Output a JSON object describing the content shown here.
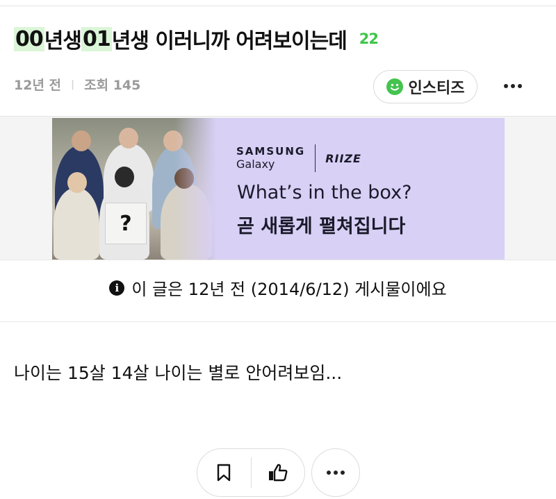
{
  "post": {
    "title_parts": [
      {
        "text": "00",
        "highlight": true
      },
      {
        "text": "년생 ",
        "highlight": false
      },
      {
        "text": "01",
        "highlight": true
      },
      {
        "text": "년생 이러니까 어려보이는데",
        "highlight": false
      }
    ],
    "comment_count": "22",
    "time_ago": "12년 전",
    "views_label": "조회 145",
    "community_name": "인스티즈",
    "notice": "이 글은 12년 전 (2014/6/12) 게시물이에요",
    "body": "나이는 15살 14살 나이는 별로 안어려보임..."
  },
  "ad": {
    "brand_line1": "SAMSUNG",
    "brand_line2": "Galaxy",
    "partner": "RIIZE",
    "headline": "What’s in the box?",
    "subline": "곧 새롭게 펼쳐집니다",
    "box_mark": "?",
    "background_color": "#d8d0f5"
  },
  "icons": {
    "more_top": "more-horizontal-icon",
    "community": "smile-icon",
    "notice": "info-icon",
    "bookmark": "bookmark-icon",
    "like": "thumbs-up-icon",
    "more_bottom": "more-horizontal-icon"
  },
  "colors": {
    "accent_green": "#3ec64a",
    "highlight_bg": "#dbf5d8",
    "meta_gray": "#9a9a9a"
  }
}
